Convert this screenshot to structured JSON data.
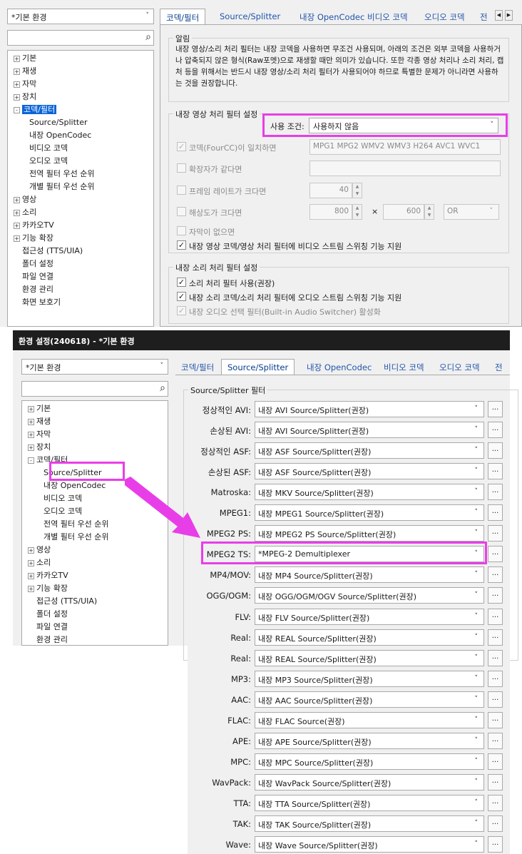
{
  "top": {
    "profile": "*기본 환경",
    "tree": [
      {
        "label": "기본",
        "pm": "+"
      },
      {
        "label": "재생",
        "pm": "+"
      },
      {
        "label": "자막",
        "pm": "+"
      },
      {
        "label": "장치",
        "pm": "+"
      },
      {
        "label": "코덱/필터",
        "pm": "-"
      },
      {
        "label": "Source/Splitter",
        "pm": ""
      },
      {
        "label": "내장 OpenCodec",
        "pm": ""
      },
      {
        "label": "비디오 코덱",
        "pm": ""
      },
      {
        "label": "오디오 코덱",
        "pm": ""
      },
      {
        "label": "전역 필터 우선 순위",
        "pm": ""
      },
      {
        "label": "개별 필터 우선 순위",
        "pm": ""
      },
      {
        "label": "영상",
        "pm": "+"
      },
      {
        "label": "소리",
        "pm": "+"
      },
      {
        "label": "카카오TV",
        "pm": "+"
      },
      {
        "label": "기능 확장",
        "pm": "+"
      },
      {
        "label": "접근성 (TTS/UIA)",
        "pm": ""
      },
      {
        "label": "폴더 설정",
        "pm": ""
      },
      {
        "label": "파일 연결",
        "pm": ""
      },
      {
        "label": "환경 관리",
        "pm": ""
      },
      {
        "label": "화면 보호기",
        "pm": ""
      }
    ],
    "tabs": [
      "코덱/필터",
      "Source/Splitter",
      "내장 OpenCodec",
      "비디오 코덱",
      "오디오 코덱",
      "전"
    ],
    "notice_title": "알림",
    "notice_text": "내장 영상/소리 처리 필터는 내장 코덱을 사용하면 무조건 사용되며, 아래의 조건은 외부 코덱을 사용하거나 압축되지 않은 형식(Raw포멧)으로 재생할 때만 의미가 있습니다. 또한 각종 영상 처리나 소리 처리, 캡처 등을 위해서는 반드시 내장 영상/소리 처리 필터가 사용되어야 하므로 특별한 문제가 아니라면 사용하는 것을 권장합니다.",
    "video_group_title": "내장 영상 처리 필터 설정",
    "use_condition_label": "사용 조건:",
    "use_condition_value": "사용하지 않음",
    "codec_check": "코덱(FourCC)이 일치하면",
    "codec_list": "MPG1 MPG2 WMV2 WMV3 H264 AVC1 WVC1",
    "ext_check": "확장자가 같다면",
    "fps_check": "프레임 레이트가 크다면",
    "fps_value": "40",
    "res_check": "해상도가 크다면",
    "res_w": "800",
    "res_x": "×",
    "res_h": "600",
    "res_op": "OR",
    "nosub_check": "자막이 없으면",
    "video_switch_check": "내장 영상 코덱/영상 처리 필터에 비디오 스트림 스위칭 기능 지원",
    "audio_group_title": "내장 소리 처리 필터 설정",
    "audio_use_check": "소리 처리 필터 사용(권장)",
    "audio_switch_check": "내장 소리 코덱/소리 처리 필터에 오디오 스트림 스위칭 기능 지원",
    "audio_sel_check": "내장 오디오 선택 필터(Built-in Audio Switcher) 활성화"
  },
  "bottom": {
    "window_title": "환경 설정(240618) - *기본 환경",
    "profile": "*기본 환경",
    "tree": [
      {
        "label": "기본",
        "pm": "+"
      },
      {
        "label": "재생",
        "pm": "+"
      },
      {
        "label": "자막",
        "pm": "+"
      },
      {
        "label": "장치",
        "pm": "+"
      },
      {
        "label": "코덱/필터",
        "pm": "-"
      },
      {
        "label": "Source/Splitter",
        "pm": ""
      },
      {
        "label": "내장 OpenCodec",
        "pm": ""
      },
      {
        "label": "비디오 코덱",
        "pm": ""
      },
      {
        "label": "오디오 코덱",
        "pm": ""
      },
      {
        "label": "전역 필터 우선 순위",
        "pm": ""
      },
      {
        "label": "개별 필터 우선 순위",
        "pm": ""
      },
      {
        "label": "영상",
        "pm": "+"
      },
      {
        "label": "소리",
        "pm": "+"
      },
      {
        "label": "카카오TV",
        "pm": "+"
      },
      {
        "label": "기능 확장",
        "pm": "+"
      },
      {
        "label": "접근성 (TTS/UIA)",
        "pm": ""
      },
      {
        "label": "폴더 설정",
        "pm": ""
      },
      {
        "label": "파일 연결",
        "pm": ""
      },
      {
        "label": "환경 관리",
        "pm": ""
      }
    ],
    "tabs": [
      "코덱/필터",
      "Source/Splitter",
      "내장 OpenCodec",
      "비디오 코덱",
      "오디오 코덱",
      "전"
    ],
    "group_title": "Source/Splitter 필터",
    "dots_label": "...",
    "rows": [
      {
        "label": "정상적인 AVI:",
        "value": "내장 AVI Source/Splitter(권장)"
      },
      {
        "label": "손상된 AVI:",
        "value": "내장 AVI Source/Splitter(권장)"
      },
      {
        "label": "정상적인 ASF:",
        "value": "내장 ASF Source/Splitter(권장)"
      },
      {
        "label": "손상된 ASF:",
        "value": "내장 ASF Source/Splitter(권장)"
      },
      {
        "label": "Matroska:",
        "value": "내장 MKV Source/Splitter(권장)"
      },
      {
        "label": "MPEG1:",
        "value": "내장 MPEG1 Source/Splitter(권장)"
      },
      {
        "label": "MPEG2 PS:",
        "value": "내장 MPEG2 PS Source/Splitter(권장)"
      },
      {
        "label": "MPEG2 TS:",
        "value": "*MPEG-2 Demultiplexer"
      },
      {
        "label": "MP4/MOV:",
        "value": "내장 MP4 Source/Splitter(권장)"
      },
      {
        "label": "OGG/OGM:",
        "value": "내장 OGG/OGM/OGV Source/Splitter(권장)"
      },
      {
        "label": "FLV:",
        "value": "내장 FLV Source/Splitter(권장)"
      },
      {
        "label": "Real:",
        "value": "내장 REAL Source/Splitter(권장)"
      },
      {
        "label": "Real:",
        "value": "내장 REAL Source/Splitter(권장)"
      },
      {
        "label": "MP3:",
        "value": "내장 MP3 Source/Splitter(권장)"
      },
      {
        "label": "AAC:",
        "value": "내장 AAC Source/Splitter(권장)"
      },
      {
        "label": "FLAC:",
        "value": "내장 FLAC Source(권장)"
      },
      {
        "label": "APE:",
        "value": "내장 APE Source/Splitter(권장)"
      },
      {
        "label": "MPC:",
        "value": "내장 MPC Source/Splitter(권장)"
      },
      {
        "label": "WavPack:",
        "value": "내장 WavPack Source/Splitter(권장)"
      },
      {
        "label": "TTA:",
        "value": "내장 TTA Source/Splitter(권장)"
      },
      {
        "label": "TAK:",
        "value": "내장 TAK Source/Splitter(권장)"
      },
      {
        "label": "Wave:",
        "value": "내장 Wave Source/Splitter(권장)"
      }
    ]
  },
  "colors": {
    "highlight": "#e83ee8",
    "selection": "#0a64d8",
    "titlebar": "#1e1e1e"
  }
}
